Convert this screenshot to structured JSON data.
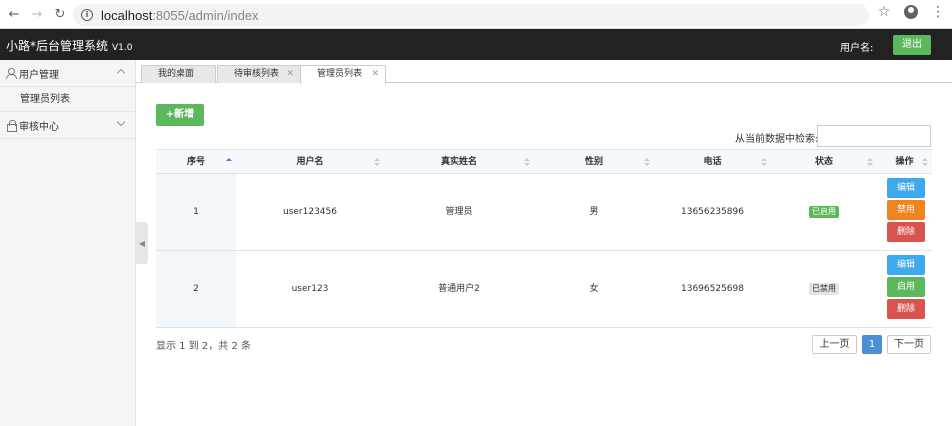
{
  "browser": {
    "url_host": "localhost",
    "url_rest": ":8055/admin/index"
  },
  "header": {
    "brand": "小路*后台管理系统",
    "version": "V1.0",
    "user_label": "用户名:",
    "logout": "退出"
  },
  "sidebar": {
    "groups": [
      {
        "label": "用户管理",
        "items": [
          {
            "label": "管理员列表"
          }
        ]
      },
      {
        "label": "审核中心",
        "items": []
      }
    ]
  },
  "tabs": [
    {
      "label": "我的桌面",
      "closable": false
    },
    {
      "label": "待审核列表",
      "closable": true
    },
    {
      "label": "管理员列表",
      "closable": true,
      "active": true
    }
  ],
  "toolbar": {
    "add_label": "+新增",
    "search_label": "从当前数据中检索:",
    "search_value": ""
  },
  "table": {
    "columns": [
      "序号",
      "用户名",
      "真实姓名",
      "性别",
      "电话",
      "状态",
      "操作"
    ],
    "rows": [
      {
        "index": "1",
        "username": "user123456",
        "realname": "管理员",
        "gender": "男",
        "phone": "13656235896",
        "status": "已启用",
        "actions": [
          "编辑",
          "禁用",
          "删除"
        ]
      },
      {
        "index": "2",
        "username": "user123",
        "realname": "普通用户2",
        "gender": "女",
        "phone": "13696525698",
        "status": "已禁用",
        "actions": [
          "编辑",
          "启用",
          "删除"
        ]
      }
    ]
  },
  "pagination": {
    "summary": "显示 1 到 2，共 2 条",
    "prev": "上一页",
    "current": "1",
    "next": "下一页"
  }
}
